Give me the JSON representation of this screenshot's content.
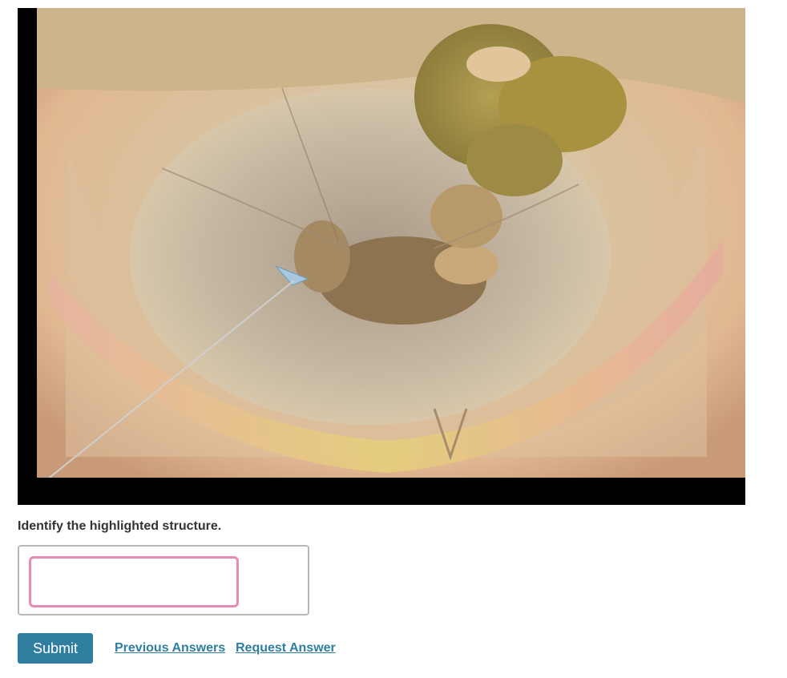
{
  "question": {
    "prompt": "Identify the highlighted structure.",
    "answer_value": "",
    "answer_placeholder": ""
  },
  "actions": {
    "submit_label": "Submit",
    "previous_answers_label": "Previous Answers",
    "request_answer_label": "Request Answer"
  },
  "colors": {
    "accent": "#2f7ea0",
    "input_focus_border": "#e78bb4",
    "highlight_marker": "#a8c8e0"
  },
  "icons": {
    "highlight_marker": "pointer-line-icon"
  }
}
